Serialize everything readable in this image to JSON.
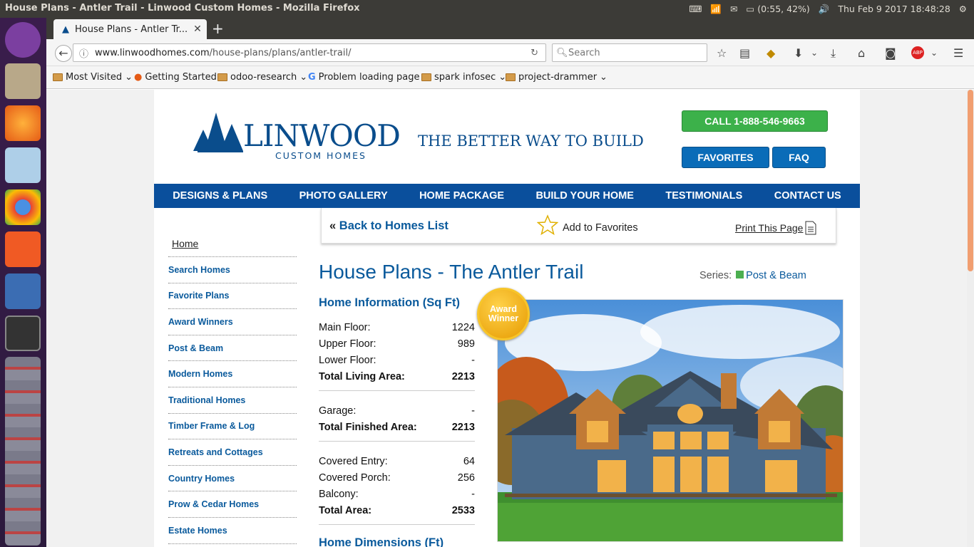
{
  "os": {
    "window_title": "House Plans - Antler Trail - Linwood Custom Homes - Mozilla Firefox",
    "battery": "(0:55, 42%)",
    "datetime": "Thu Feb  9 2017 18:48:28"
  },
  "browser": {
    "tab_title": "House Plans - Antler Tr...",
    "url_domain": "www.linwoodhomes.com",
    "url_path": "/house-plans/plans/antler-trail/",
    "search_placeholder": "Search",
    "bookmarks": [
      "Most Visited",
      "Getting Started",
      "odoo-research",
      "Problem loading page",
      "spark infosec",
      "project-drammer"
    ]
  },
  "site": {
    "logo_text": "LINWOOD",
    "logo_sub": "CUSTOM  HOMES",
    "tagline": "THE BETTER WAY TO BUILD",
    "call_button": "CALL 1-888-546-9663",
    "favorites_button": "FAVORITES",
    "faq_button": "FAQ",
    "nav": [
      "DESIGNS & PLANS",
      "PHOTO GALLERY",
      "HOME PACKAGE",
      "BUILD YOUR HOME",
      "TESTIMONIALS",
      "CONTACT US"
    ]
  },
  "sidebar": {
    "home": "Home",
    "items": [
      "Search Homes",
      "Favorite Plans",
      "Award Winners",
      "Post & Beam",
      "Modern Homes",
      "Traditional Homes",
      "Timber Frame & Log",
      "Retreats and Cottages",
      "Country Homes",
      "Prow & Cedar Homes",
      "Estate Homes"
    ]
  },
  "actions": {
    "back": "Back to Homes List",
    "back_prefix": "«",
    "add_favorites": "Add to Favorites",
    "print": "Print This Page"
  },
  "plan": {
    "title": "House Plans - The Antler Trail",
    "series_label": "Series:",
    "series_value": "Post & Beam",
    "award": "Award Winner",
    "info_heading": "Home Information (Sq Ft)",
    "dims_heading": "Home Dimensions (Ft)",
    "groups": [
      [
        {
          "label": "Main Floor:",
          "value": "1224",
          "bold": false
        },
        {
          "label": "Upper Floor:",
          "value": "989",
          "bold": false
        },
        {
          "label": "Lower Floor:",
          "value": "-",
          "bold": false
        },
        {
          "label": "Total Living Area:",
          "value": "2213",
          "bold": true
        }
      ],
      [
        {
          "label": "Garage:",
          "value": "-",
          "bold": false
        },
        {
          "label": "Total Finished Area:",
          "value": "2213",
          "bold": true
        }
      ],
      [
        {
          "label": "Covered Entry:",
          "value": "64",
          "bold": false
        },
        {
          "label": "Covered Porch:",
          "value": "256",
          "bold": false
        },
        {
          "label": "Balcony:",
          "value": "-",
          "bold": false
        },
        {
          "label": "Total Area:",
          "value": "2533",
          "bold": true
        }
      ]
    ]
  },
  "colors": {
    "brand": "#0a4f9c",
    "call": "#3cb14a",
    "link": "#0a5a9c"
  }
}
